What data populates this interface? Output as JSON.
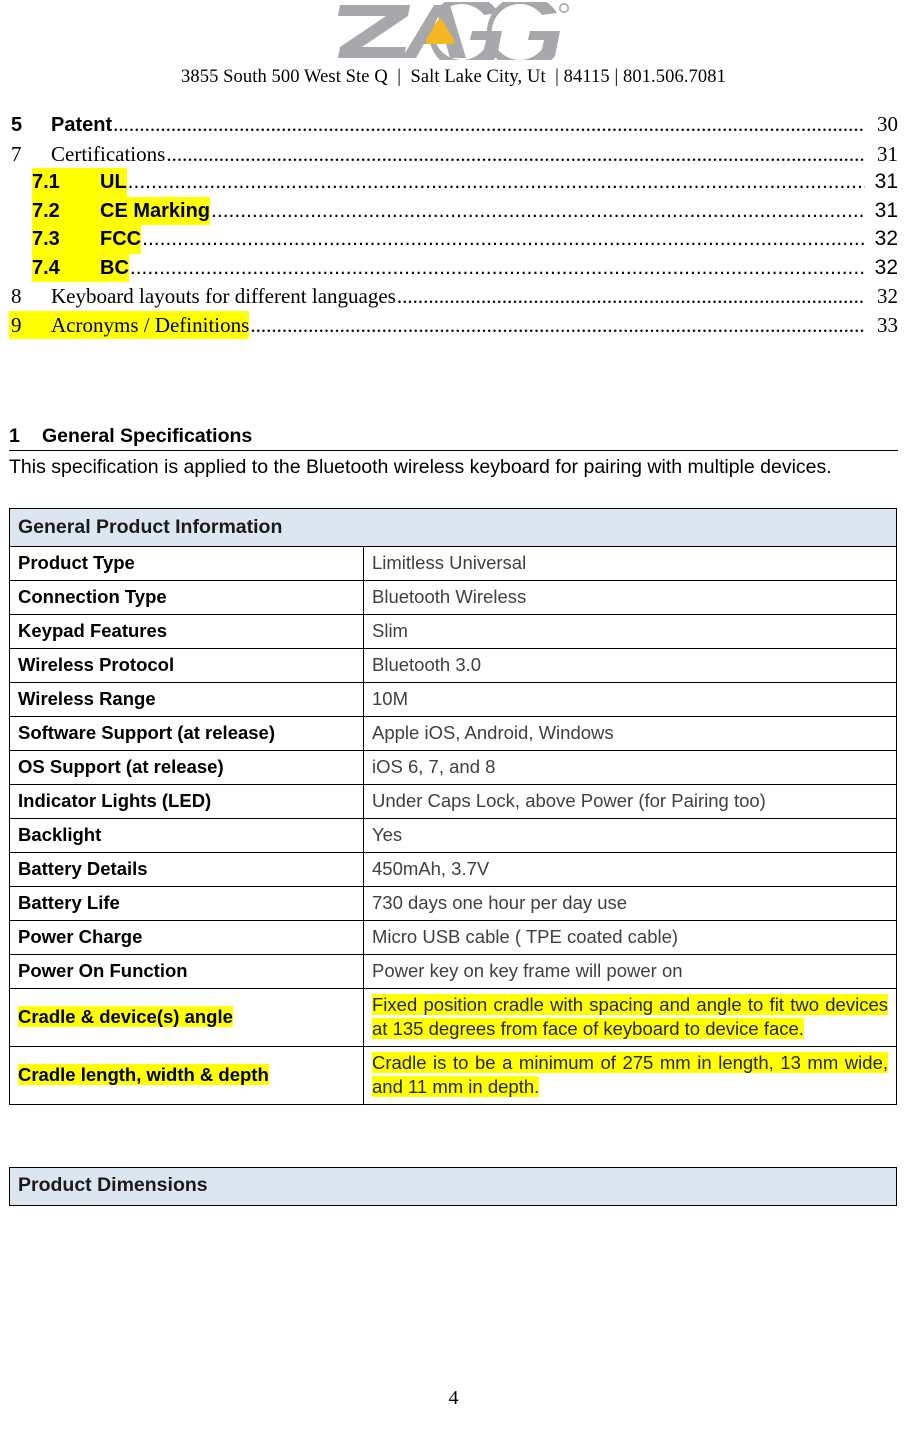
{
  "header": {
    "logo_text": "ZAGG",
    "logo_gray": "#a6a8ab",
    "logo_accent": "#f5b820",
    "address": "3855 South 500 West Ste Q  |  Salt Lake City, Ut  | 84115 | 801.506.7081"
  },
  "toc": {
    "entries": [
      {
        "num": "5",
        "label": "Patent",
        "page": "30",
        "level": 1,
        "style": "sans",
        "hl_num": false,
        "hl_label": false
      },
      {
        "num": "7",
        "label": "Certifications",
        "page": "31",
        "level": 1,
        "style": "serif",
        "hl_num": false,
        "hl_label": false
      },
      {
        "num": "7.1",
        "label": "UL",
        "page": "31",
        "level": 2,
        "style": "sans",
        "hl_num": true,
        "hl_label": true
      },
      {
        "num": "7.2",
        "label": "CE Marking",
        "page": "31",
        "level": 2,
        "style": "sans",
        "hl_num": true,
        "hl_label": true
      },
      {
        "num": "7.3",
        "label": "FCC",
        "page": "32",
        "level": 2,
        "style": "sans",
        "hl_num": true,
        "hl_label": true
      },
      {
        "num": "7.4",
        "label": "BC",
        "page": "32",
        "level": 2,
        "style": "sans",
        "hl_num": true,
        "hl_label": true
      },
      {
        "num": "8",
        "label": "Keyboard layouts for different languages",
        "page": "32",
        "level": 1,
        "style": "serif",
        "hl_num": false,
        "hl_label": false
      },
      {
        "num": "9",
        "label": "Acronyms / Definitions",
        "page": "33",
        "level": 1,
        "style": "serif",
        "hl_num": true,
        "hl_label": true
      }
    ],
    "dot_leader": "................................................................................................................................................................"
  },
  "section": {
    "number": "1",
    "title": "General Specifications",
    "body": "This specification is applied to the Bluetooth wireless keyboard for pairing with multiple devices."
  },
  "spec_table": {
    "header": "General Product Information",
    "rows": [
      {
        "key": "Product Type",
        "value": "Limitless Universal",
        "hl_key": false,
        "hl_value": false,
        "justify": false
      },
      {
        "key": "Connection Type",
        "value": "Bluetooth Wireless",
        "hl_key": false,
        "hl_value": false,
        "justify": false
      },
      {
        "key": "Keypad Features",
        "value": "Slim",
        "hl_key": false,
        "hl_value": false,
        "justify": false
      },
      {
        "key": "Wireless Protocol",
        "value": "Bluetooth 3.0",
        "hl_key": false,
        "hl_value": false,
        "justify": false
      },
      {
        "key": "Wireless Range",
        "value": "10M",
        "hl_key": false,
        "hl_value": false,
        "justify": false
      },
      {
        "key": "Software Support (at release)",
        "value": "Apple iOS, Android, Windows",
        "hl_key": false,
        "hl_value": false,
        "justify": false
      },
      {
        "key": "OS Support (at release)",
        "value": "iOS 6, 7, and 8",
        "hl_key": false,
        "hl_value": false,
        "justify": false
      },
      {
        "key": "Indicator Lights (LED)",
        "value": "Under Caps Lock, above Power (for Pairing too)",
        "hl_key": false,
        "hl_value": false,
        "justify": false
      },
      {
        "key": "Backlight",
        "value": "Yes",
        "hl_key": false,
        "hl_value": false,
        "justify": false
      },
      {
        "key": "Battery Details",
        "value": "450mAh, 3.7V",
        "hl_key": false,
        "hl_value": false,
        "justify": false
      },
      {
        "key": "Battery Life",
        "value": "730 days one hour per day use",
        "hl_key": false,
        "hl_value": false,
        "justify": false
      },
      {
        "key": "Power Charge",
        "value": "Micro USB cable ( TPE coated cable)",
        "hl_key": false,
        "hl_value": false,
        "justify": false
      },
      {
        "key": "Power On Function",
        "value": "Power key on key frame will power on",
        "hl_key": false,
        "hl_value": false,
        "justify": false
      },
      {
        "key": "Cradle &  device(s) angle",
        "value": "Fixed position cradle with spacing and angle to fit two devices at 135 degrees from face of keyboard to device face.",
        "hl_key": true,
        "hl_value": true,
        "justify": true
      },
      {
        "key": "Cradle length, width & depth",
        "value": "Cradle is to be a minimum of 275 mm in length, 13 mm wide, and 11 mm in depth.",
        "hl_key": true,
        "hl_value": true,
        "justify": true
      }
    ]
  },
  "dims_table": {
    "header": "Product Dimensions"
  },
  "footer": {
    "page_number": "4"
  }
}
